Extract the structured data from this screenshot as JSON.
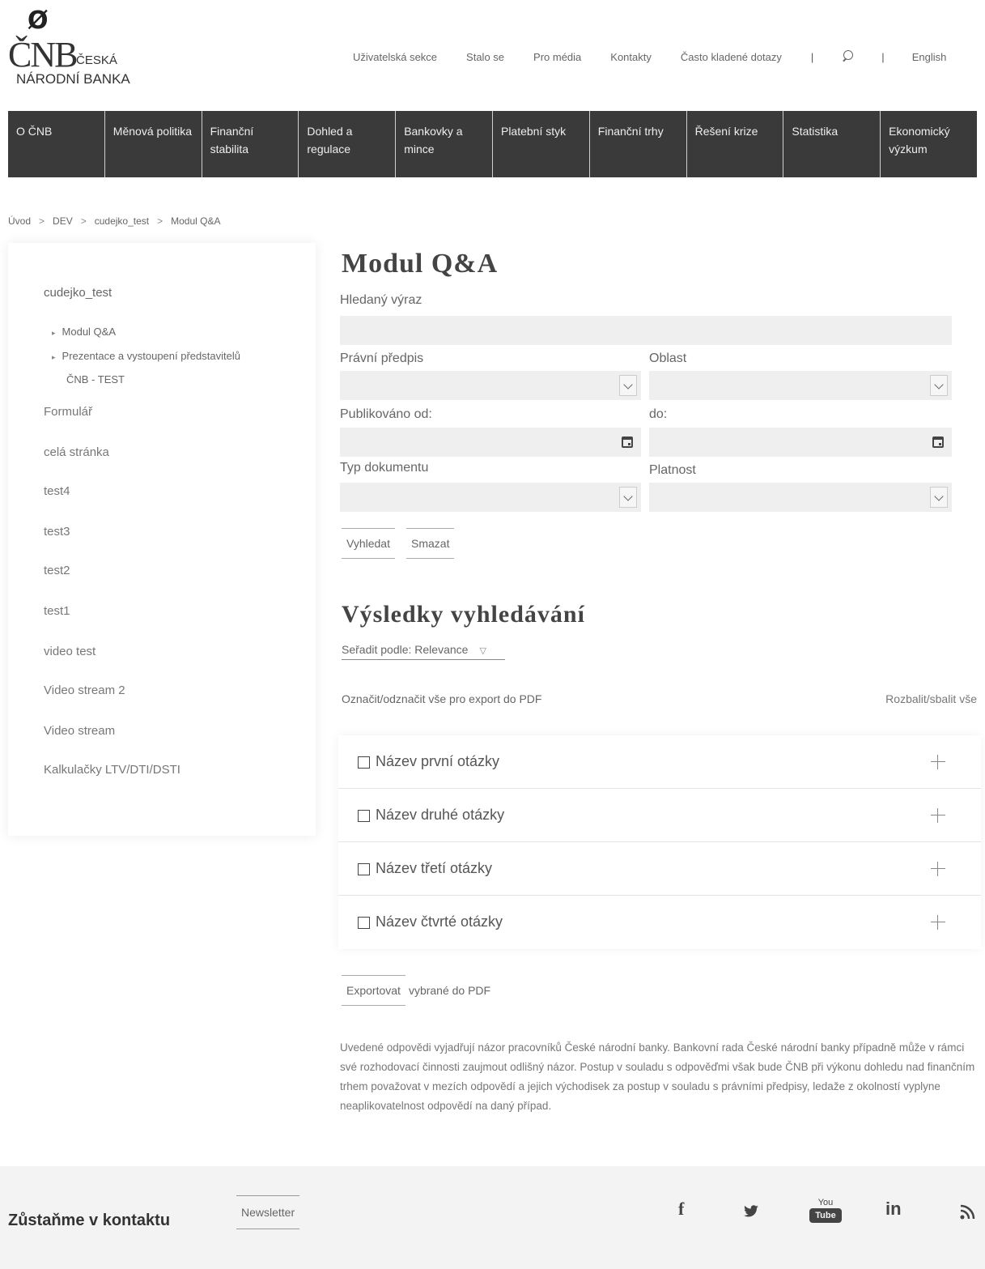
{
  "logo": {
    "mark": "Ø",
    "cnb": "ČNB",
    "line1": "ČESKÁ",
    "line2": "NÁRODNÍ BANKA"
  },
  "topnav": {
    "items": [
      "Uživatelská sekce",
      "Stalo se",
      "Pro média",
      "Kontakty",
      "Často kladené dotazy"
    ],
    "separator": "|",
    "language": "English"
  },
  "mainnav": {
    "items": [
      "O ČNB",
      "Měnová politika",
      "Finanční stabilita",
      "Dohled a regulace",
      "Bankovky a mince",
      "Platební styk",
      "Finanční trhy",
      "Řešení krize",
      "Statistika",
      "Ekonomický výzkum"
    ]
  },
  "breadcrumb": {
    "items": [
      "Úvod",
      "DEV",
      "cudejko_test",
      "Modul Q&A"
    ],
    "separator": ">"
  },
  "sidebar": {
    "root": "cudejko_test",
    "subitems": [
      "Modul Q&A",
      "Prezentace a vystoupení představitelů",
      "ČNB - TEST"
    ],
    "items": [
      "Formulář",
      "celá stránka",
      "test4",
      "test3",
      "test2",
      "test1",
      "video test",
      "Video stream 2",
      "Video stream",
      "Kalkulačky LTV/DTI/DSTI"
    ]
  },
  "main": {
    "title": "Modul Q&A",
    "form": {
      "search_label": "Hledaný výraz",
      "legal_label": "Právní předpis",
      "area_label": "Oblast",
      "published_from_label": "Publikováno od:",
      "published_to_label": "do:",
      "doc_type_label": "Typ dokumentu",
      "validity_label": "Platnost",
      "search_button": "Vyhledat",
      "clear_button": "Smazat"
    },
    "results": {
      "title": "Výsledky vyhledávání",
      "sort_label": "Seřadit podle: Relevance",
      "mark_all": "Označit/odznačit vše pro export do PDF",
      "expand_all": "Rozbalit/sbalit vše",
      "questions": [
        "Název první otázky",
        "Název druhé otázky",
        "Název třetí otázky",
        "Název čtvrté otázky"
      ]
    },
    "export": {
      "button": "Exportovat",
      "text": "vybrané do PDF"
    },
    "disclaimer": "Uvedené odpovědi vyjadřují názor pracovníků České národní banky. Bankovní rada České národní banky případně může v rámci své rozhodovací činnosti zaujmout odlišný názor. Postup v souladu s odpověďmi však bude ČNB při výkonu dohledu nad finančním trhem považovat v mezích odpovědí a jejich východisek za postup v souladu s právními předpisy, ledaže z okolností vyplyne neaplikovatelnost odpovědí na daný případ."
  },
  "footer": {
    "title": "Zůstaňme v kontaktu",
    "newsletter": "Newsletter",
    "social": {
      "facebook": "f",
      "linkedin": "in",
      "youtube_top": "You",
      "youtube_bottom": "Tube"
    },
    "icons": [
      "facebook-icon",
      "twitter-icon",
      "youtube-icon",
      "linkedin-icon",
      "rss-icon"
    ]
  }
}
